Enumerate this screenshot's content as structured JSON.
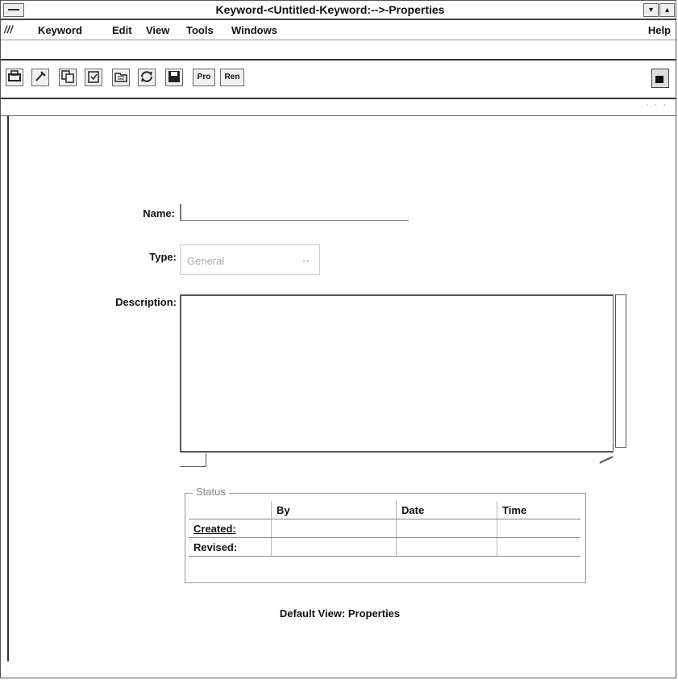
{
  "window": {
    "title": "Keyword-<Untitled-Keyword:-->-Properties",
    "minimize": "▾",
    "maximize": "▴"
  },
  "menubar": {
    "icon": "///",
    "items": [
      {
        "label": "Keyword"
      },
      {
        "label": "Edit"
      },
      {
        "label": "View"
      },
      {
        "label": "Tools"
      },
      {
        "label": "Windows"
      }
    ],
    "help": "Help"
  },
  "toolbar": {
    "buttons": [
      {
        "icon": "print-icon"
      },
      {
        "icon": "tools-icon"
      },
      {
        "icon": "copy-icon"
      },
      {
        "icon": "paste-icon"
      },
      {
        "icon": "folder-icon"
      },
      {
        "icon": "refresh-icon"
      },
      {
        "icon": "save-icon"
      }
    ],
    "pro_label": "Pro",
    "ren_label": "Ren",
    "lock_icon": "lock-icon",
    "subbar_dots": "· · ·"
  },
  "form": {
    "name_label": "Name:",
    "name_value": "",
    "type_label": "Type:",
    "type_value": "General",
    "type_arrow": "↔",
    "description_label": "Description:",
    "description_value": ""
  },
  "status": {
    "legend": "Status",
    "columns": [
      "",
      "By",
      "Date",
      "Time"
    ],
    "rows": [
      {
        "label": "Created:",
        "by": "",
        "date": "",
        "time": ""
      },
      {
        "label": "Revised:",
        "by": "",
        "date": "",
        "time": ""
      }
    ]
  },
  "footer": {
    "default_view": "Default View: Properties"
  }
}
